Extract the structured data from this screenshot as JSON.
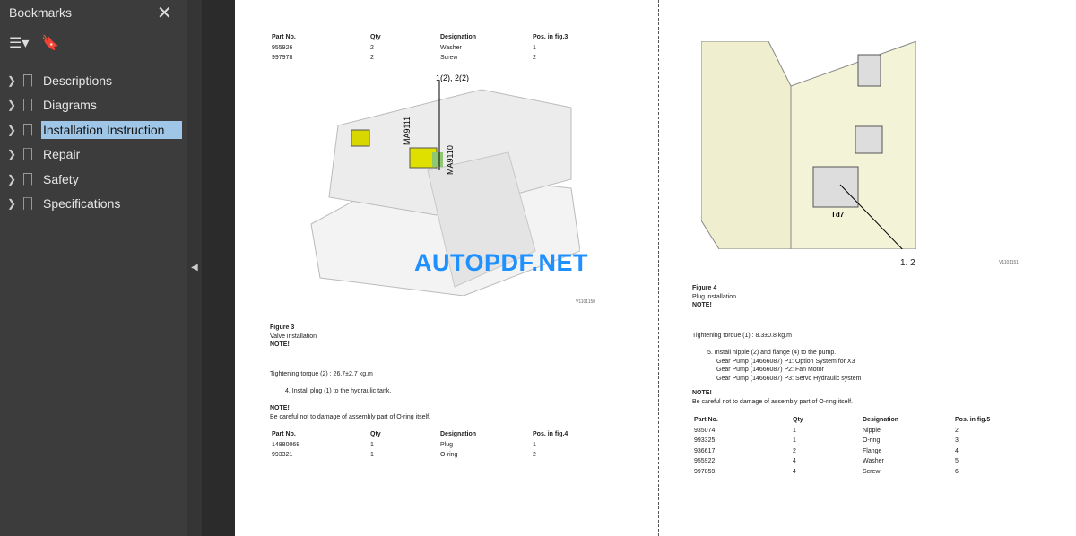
{
  "sidebar": {
    "title": "Bookmarks",
    "close_icon": "close-icon",
    "items": [
      {
        "label": "Descriptions"
      },
      {
        "label": "Diagrams"
      },
      {
        "label": "Installation Instruction",
        "selected": true
      },
      {
        "label": "Repair"
      },
      {
        "label": "Safety"
      },
      {
        "label": "Specifications"
      }
    ]
  },
  "watermark": "AUTOPDF.NET",
  "left": {
    "table1": {
      "headers": [
        "Part No.",
        "Qty",
        "Designation",
        "Pos. in fig.3"
      ],
      "rows": [
        [
          "955926",
          "2",
          "Washer",
          "1"
        ],
        [
          "997978",
          "2",
          "Screw",
          "2"
        ]
      ]
    },
    "fig_labels": {
      "callout": "1(2), 2(2)",
      "ma1": "MA9111",
      "ma2": "MA9110",
      "fig_id": "V1101150"
    },
    "figure_title": "Figure 3",
    "figure_caption": "Valve installation",
    "note1": "NOTE!",
    "torque": "Tightening torque (2) : 26.7±2.7 kg.m",
    "step": "4.  Install plug (1) to the hydraulic tank.",
    "note2": "NOTE!",
    "note2_text": "Be careful not to damage of assembly part of O-ring itself.",
    "table2": {
      "headers": [
        "Part No.",
        "Qty",
        "Designation",
        "Pos. in fig.4"
      ],
      "rows": [
        [
          "14880068",
          "1",
          "Plug",
          "1"
        ],
        [
          "993321",
          "1",
          "O-ring",
          "2"
        ]
      ]
    }
  },
  "right": {
    "fig_labels": {
      "td": "Td7",
      "callout": "1. 2",
      "fig_id": "V1101151"
    },
    "figure_title": "Figure 4",
    "figure_caption": "Plug installation",
    "note1": "NOTE!",
    "torque": "Tightening torque (1) : 8.3±0.8 kg.m",
    "step": "5.  Install nipple (2) and flange (4) to the pump.",
    "step_lines": [
      "Gear Pump (14666087) P1: Option System for X3",
      "Gear Pump (14666087) P2: Fan Motor",
      "Gear Pump (14666087) P3: Servo Hydraulic system"
    ],
    "note2": "NOTE!",
    "note2_text": "Be careful not to damage of assembly part of O-ring itself.",
    "table": {
      "headers": [
        "Part No.",
        "Qty",
        "Designation",
        "Pos. in fig.5"
      ],
      "rows": [
        [
          "935074",
          "1",
          "Nipple",
          "2"
        ],
        [
          "993325",
          "1",
          "O-ring",
          "3"
        ],
        [
          "936617",
          "2",
          "Flange",
          "4"
        ],
        [
          "955922",
          "4",
          "Washer",
          "5"
        ],
        [
          "997859",
          "4",
          "Screw",
          "6"
        ]
      ]
    }
  }
}
